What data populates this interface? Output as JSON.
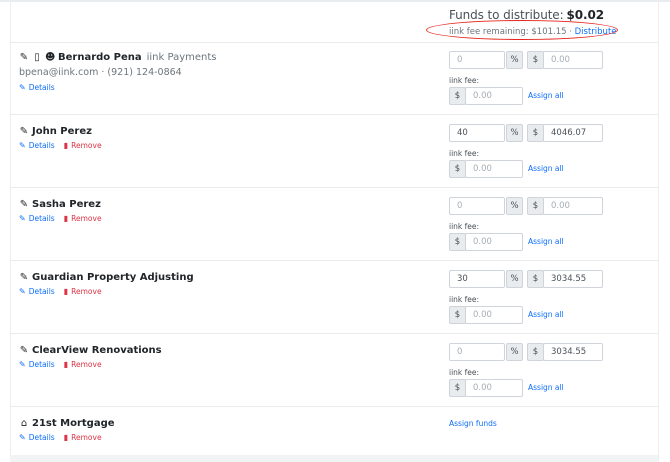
{
  "funds": {
    "label": "Funds to distribute:",
    "amount": "$0.02",
    "fee_remaining": "iink fee remaining: $101.15",
    "separator": "·",
    "distribute": "Distribute"
  },
  "common": {
    "details": "Details",
    "remove": "Remove",
    "fee_label": "iink fee:",
    "assign_all": "Assign all",
    "percent_symbol": "%",
    "dollar_symbol": "$",
    "fee_placeholder": "0.00"
  },
  "payees": [
    {
      "name": "Bernardo Pena",
      "subtext": "iink Payments",
      "contact": "bpena@iink.com · (921) 124-0864",
      "icons": [
        "pen-icon",
        "clipboard-icon",
        "user-check-icon"
      ],
      "percent": "0",
      "percent_placeholder": true,
      "amount": "0.00",
      "amount_placeholder": true
    },
    {
      "name": "John Perez",
      "icons": [
        "pen-icon"
      ],
      "percent": "40",
      "percent_placeholder": false,
      "amount": "4046.07",
      "amount_placeholder": false
    },
    {
      "name": "Sasha Perez",
      "icons": [
        "pen-icon"
      ],
      "percent": "0",
      "percent_placeholder": true,
      "amount": "0.00",
      "amount_placeholder": true
    },
    {
      "name": "Guardian Property Adjusting",
      "icons": [
        "pen-icon"
      ],
      "percent": "30",
      "percent_placeholder": false,
      "amount": "3034.55",
      "amount_placeholder": false
    },
    {
      "name": "ClearView Renovations",
      "icons": [
        "pen-icon"
      ],
      "percent": "0",
      "percent_placeholder": true,
      "amount": "3034.55",
      "amount_placeholder": false
    },
    {
      "name": "21st Mortgage",
      "icons": [
        "bank-icon"
      ],
      "assign_funds": "Assign funds"
    }
  ],
  "colors": {
    "link": "#0d6efd",
    "remove": "#dc3545",
    "highlight_ellipse": "#e4261f"
  }
}
